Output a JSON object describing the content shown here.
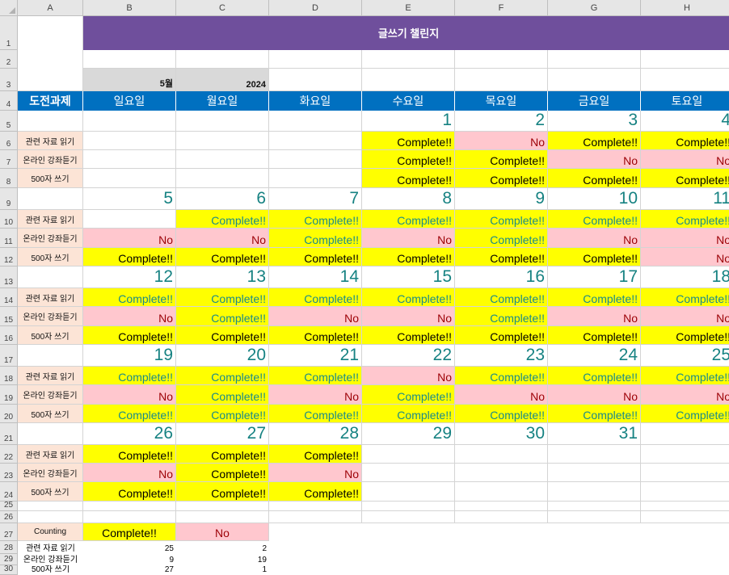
{
  "columns": [
    "A",
    "B",
    "C",
    "D",
    "E",
    "F",
    "G",
    "H"
  ],
  "rows": [
    "1",
    "2",
    "3",
    "4",
    "5",
    "6",
    "7",
    "8",
    "9",
    "10",
    "11",
    "12",
    "13",
    "14",
    "15",
    "16",
    "17",
    "18",
    "19",
    "20",
    "21",
    "22",
    "23",
    "24",
    "25",
    "26",
    "27",
    "28",
    "29",
    "30"
  ],
  "title": "글쓰기 챌린지",
  "month": "5월",
  "year": "2024",
  "header_label": "도전과제",
  "days": [
    "일요일",
    "월요일",
    "화요일",
    "수요일",
    "목요일",
    "금요일",
    "토요일"
  ],
  "tasks": [
    "관련 자료 읽기",
    "온라인 강좌듣기",
    "500자 쓰기"
  ],
  "weeks": [
    {
      "dates": [
        "",
        "",
        "",
        "1",
        "2",
        "3",
        "4"
      ],
      "status": [
        [
          "",
          "",
          "",
          "Complete!!",
          "No",
          "Complete!!",
          "Complete!!"
        ],
        [
          "",
          "",
          "",
          "Complete!!",
          "Complete!!",
          "No",
          "No"
        ],
        [
          "",
          "",
          "",
          "Complete!!",
          "Complete!!",
          "Complete!!",
          "Complete!!"
        ]
      ]
    },
    {
      "dates": [
        "5",
        "6",
        "7",
        "8",
        "9",
        "10",
        "11"
      ],
      "status": [
        [
          "",
          "Complete!!",
          "Complete!!",
          "Complete!!",
          "Complete!!",
          "Complete!!",
          "Complete!!"
        ],
        [
          "No",
          "No",
          "Complete!!",
          "No",
          "Complete!!",
          "No",
          "No"
        ],
        [
          "Complete!!",
          "Complete!!",
          "Complete!!",
          "Complete!!",
          "Complete!!",
          "Complete!!",
          "No"
        ]
      ]
    },
    {
      "dates": [
        "12",
        "13",
        "14",
        "15",
        "16",
        "17",
        "18"
      ],
      "status": [
        [
          "Complete!!",
          "Complete!!",
          "Complete!!",
          "Complete!!",
          "Complete!!",
          "Complete!!",
          "Complete!!"
        ],
        [
          "No",
          "Complete!!",
          "No",
          "No",
          "Complete!!",
          "No",
          "No"
        ],
        [
          "Complete!!",
          "Complete!!",
          "Complete!!",
          "Complete!!",
          "Complete!!",
          "Complete!!",
          "Complete!!"
        ]
      ]
    },
    {
      "dates": [
        "19",
        "20",
        "21",
        "22",
        "23",
        "24",
        "25"
      ],
      "status": [
        [
          "Complete!!",
          "Complete!!",
          "Complete!!",
          "No",
          "Complete!!",
          "Complete!!",
          "Complete!!"
        ],
        [
          "No",
          "Complete!!",
          "No",
          "Complete!!",
          "No",
          "No",
          "No"
        ],
        [
          "Complete!!",
          "Complete!!",
          "Complete!!",
          "Complete!!",
          "Complete!!",
          "Complete!!",
          "Complete!!"
        ]
      ]
    },
    {
      "dates": [
        "26",
        "27",
        "28",
        "29",
        "30",
        "31",
        ""
      ],
      "status": [
        [
          "Complete!!",
          "Complete!!",
          "Complete!!",
          "",
          "",
          "",
          ""
        ],
        [
          "No",
          "Complete!!",
          "No",
          "",
          "",
          "",
          ""
        ],
        [
          "Complete!!",
          "Complete!!",
          "Complete!!",
          "",
          "",
          "",
          ""
        ]
      ]
    }
  ],
  "counting": {
    "label": "Counting",
    "complete_label": "Complete!!",
    "no_label": "No",
    "rows": [
      {
        "task": "관련 자료 읽기",
        "complete": "25",
        "no": "2"
      },
      {
        "task": "온라인 강좌듣기",
        "complete": "9",
        "no": "19"
      },
      {
        "task": "500자 쓰기",
        "complete": "27",
        "no": "1"
      }
    ]
  },
  "colors": {
    "title_bg": "#6f4f9c",
    "day_header_bg": "#0070c0",
    "complete_bg": "#ffff00",
    "no_bg": "#ffc7ce",
    "no_text": "#9c0006",
    "date_text": "#168282",
    "task_label_bg": "#fce4d6"
  }
}
